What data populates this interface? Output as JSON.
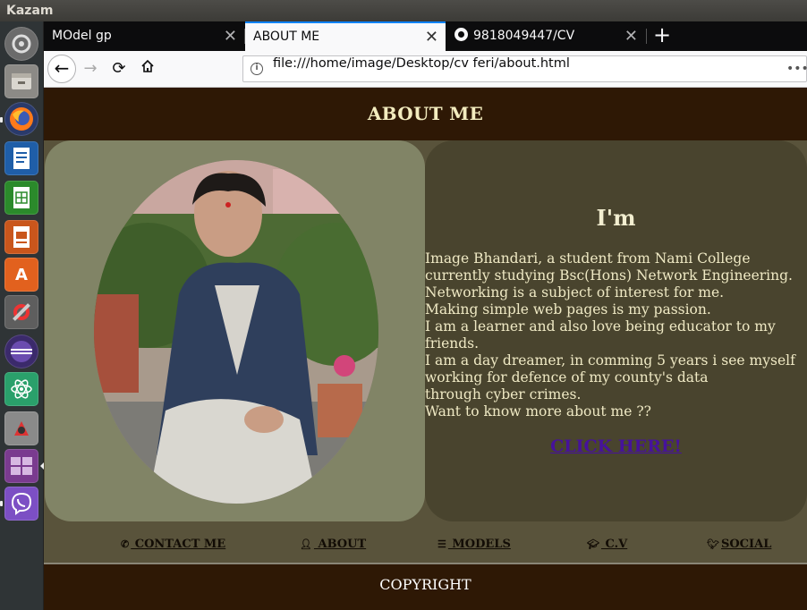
{
  "os": {
    "app_title": "Kazam"
  },
  "browser": {
    "tabs": [
      {
        "label": "MOdel gp"
      },
      {
        "label": "ABOUT ME"
      },
      {
        "label": "9818049447/CV"
      }
    ],
    "url": "file:///home/image/Desktop/cv feri/about.html"
  },
  "page": {
    "header": "ABOUT ME",
    "intro_title": "I'm",
    "intro_text": "Image Bhandari, a student from Nami College\ncurrently studying Bsc(Hons) Network Engineering.\nNetworking is a subject of interest for me.\nMaking simple web pages is my passion.\nI am a learner and also love being educator to my\nfriends.\nI am a day dreamer, in comming 5 years i see myself\nworking for defence of my county's data\nthrough cyber crimes.\nWant to know more about me ??",
    "cta": "CLICK HERE!",
    "footer_nav": [
      {
        "label": " CONTACT ME",
        "icon": "phone-icon"
      },
      {
        "label": " ABOUT",
        "icon": "user-icon"
      },
      {
        "label": " MODELS",
        "icon": "sliders-icon"
      },
      {
        "label": " C.V",
        "icon": "graduation-cap-icon"
      },
      {
        "label": "SOCIAL",
        "icon": "twitter-icon"
      }
    ],
    "copyright": "COPYRIGHT"
  },
  "colors": {
    "header_bg": "#2e1805",
    "photo_panel": "#818466",
    "info_panel": "#49442e",
    "link": "#46129b"
  }
}
